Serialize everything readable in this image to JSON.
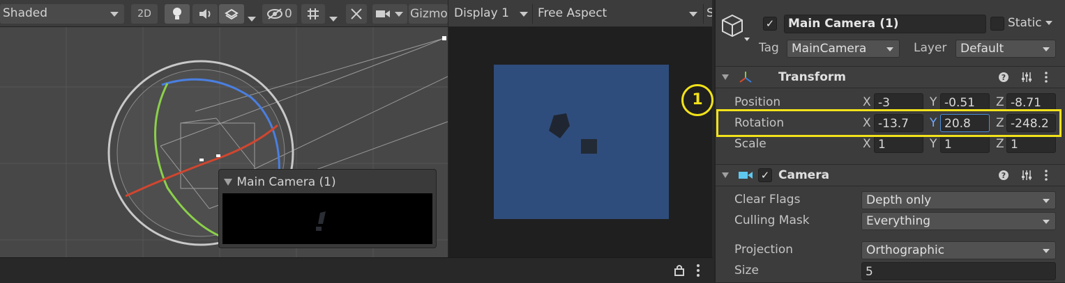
{
  "scene_view": {
    "toolbar": {
      "shading_mode": "Shaded",
      "mode_2d": "2D",
      "hidden_count": "0",
      "gizmos_label": "Gizmo"
    },
    "camera_preview": {
      "title": "Main Camera (1)"
    }
  },
  "game_view": {
    "toolbar": {
      "display": "Display 1",
      "aspect": "Free Aspect",
      "scale_initial": "S"
    },
    "background_color": "#2f4d7c"
  },
  "inspector": {
    "object": {
      "active": true,
      "name": "Main Camera (1)",
      "static_label": "Static",
      "tag_label": "Tag",
      "tag_value": "MainCamera",
      "layer_label": "Layer",
      "layer_value": "Default"
    },
    "transform": {
      "title": "Transform",
      "position": {
        "label": "Position",
        "x": "-3",
        "y": "-0.51",
        "z": "-8.71"
      },
      "rotation": {
        "label": "Rotation",
        "x": "-13.7",
        "y": "20.8",
        "z": "-248.2"
      },
      "scale": {
        "label": "Scale",
        "x": "1",
        "y": "1",
        "z": "1"
      }
    },
    "camera": {
      "title": "Camera",
      "enabled": true,
      "clear_flags": {
        "label": "Clear Flags",
        "value": "Depth only"
      },
      "culling_mask": {
        "label": "Culling Mask",
        "value": "Everything"
      },
      "projection": {
        "label": "Projection",
        "value": "Orthographic"
      },
      "size": {
        "label": "Size",
        "value": "5"
      }
    }
  },
  "annotation": {
    "marker": "1",
    "color": "#f2e21a"
  },
  "axis_labels": {
    "x": "X",
    "y": "Y",
    "z": "Z"
  }
}
